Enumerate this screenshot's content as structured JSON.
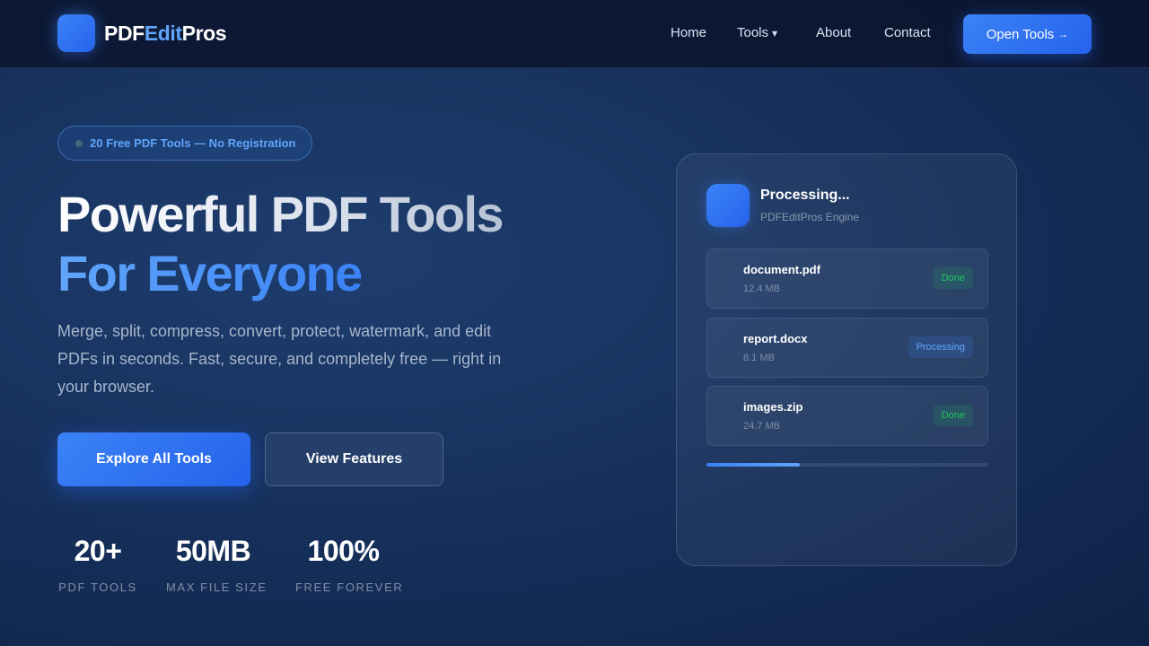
{
  "nav": {
    "brand": {
      "part1": "PDF",
      "part2": "Edit",
      "part3": "Pros"
    },
    "links": [
      {
        "label": "Home"
      },
      {
        "label": "Tools",
        "glyph": "▾"
      },
      {
        "label": "About"
      },
      {
        "label": "Contact"
      }
    ],
    "cta": {
      "label": "Open Tools",
      "glyph": "→"
    }
  },
  "hero": {
    "pill": "20 Free PDF Tools — No Registration",
    "headline_line1": "Powerful PDF Tools",
    "headline_line2": "For Everyone",
    "subtext": "Merge, split, compress, convert, protect, watermark, and edit PDFs in seconds. Fast, secure, and completely free — right in your browser.",
    "primary_button": "Explore All Tools",
    "secondary_button": "View Features",
    "stats": [
      {
        "value": "20+",
        "label": "PDF TOOLS"
      },
      {
        "value": "50MB",
        "label": "MAX FILE SIZE"
      },
      {
        "value": "100%",
        "label": "FREE FOREVER"
      }
    ]
  },
  "card": {
    "title": "Processing...",
    "subtitle": "PDFEditPros Engine",
    "files": [
      {
        "name": "document.pdf",
        "size": "12.4 MB",
        "status": "Done"
      },
      {
        "name": "report.docx",
        "size": "8.1 MB",
        "status": "Processing"
      },
      {
        "name": "images.zip",
        "size": "24.7 MB",
        "status": "Done"
      }
    ],
    "progress": 0.33
  },
  "colors": {
    "accent": "#3b82f6",
    "accent_light": "#60a5fa",
    "done": "#22c55e",
    "background": "#183461"
  },
  "icons": {
    "logo": "logo-icon",
    "engine": "engine-logo-icon"
  }
}
